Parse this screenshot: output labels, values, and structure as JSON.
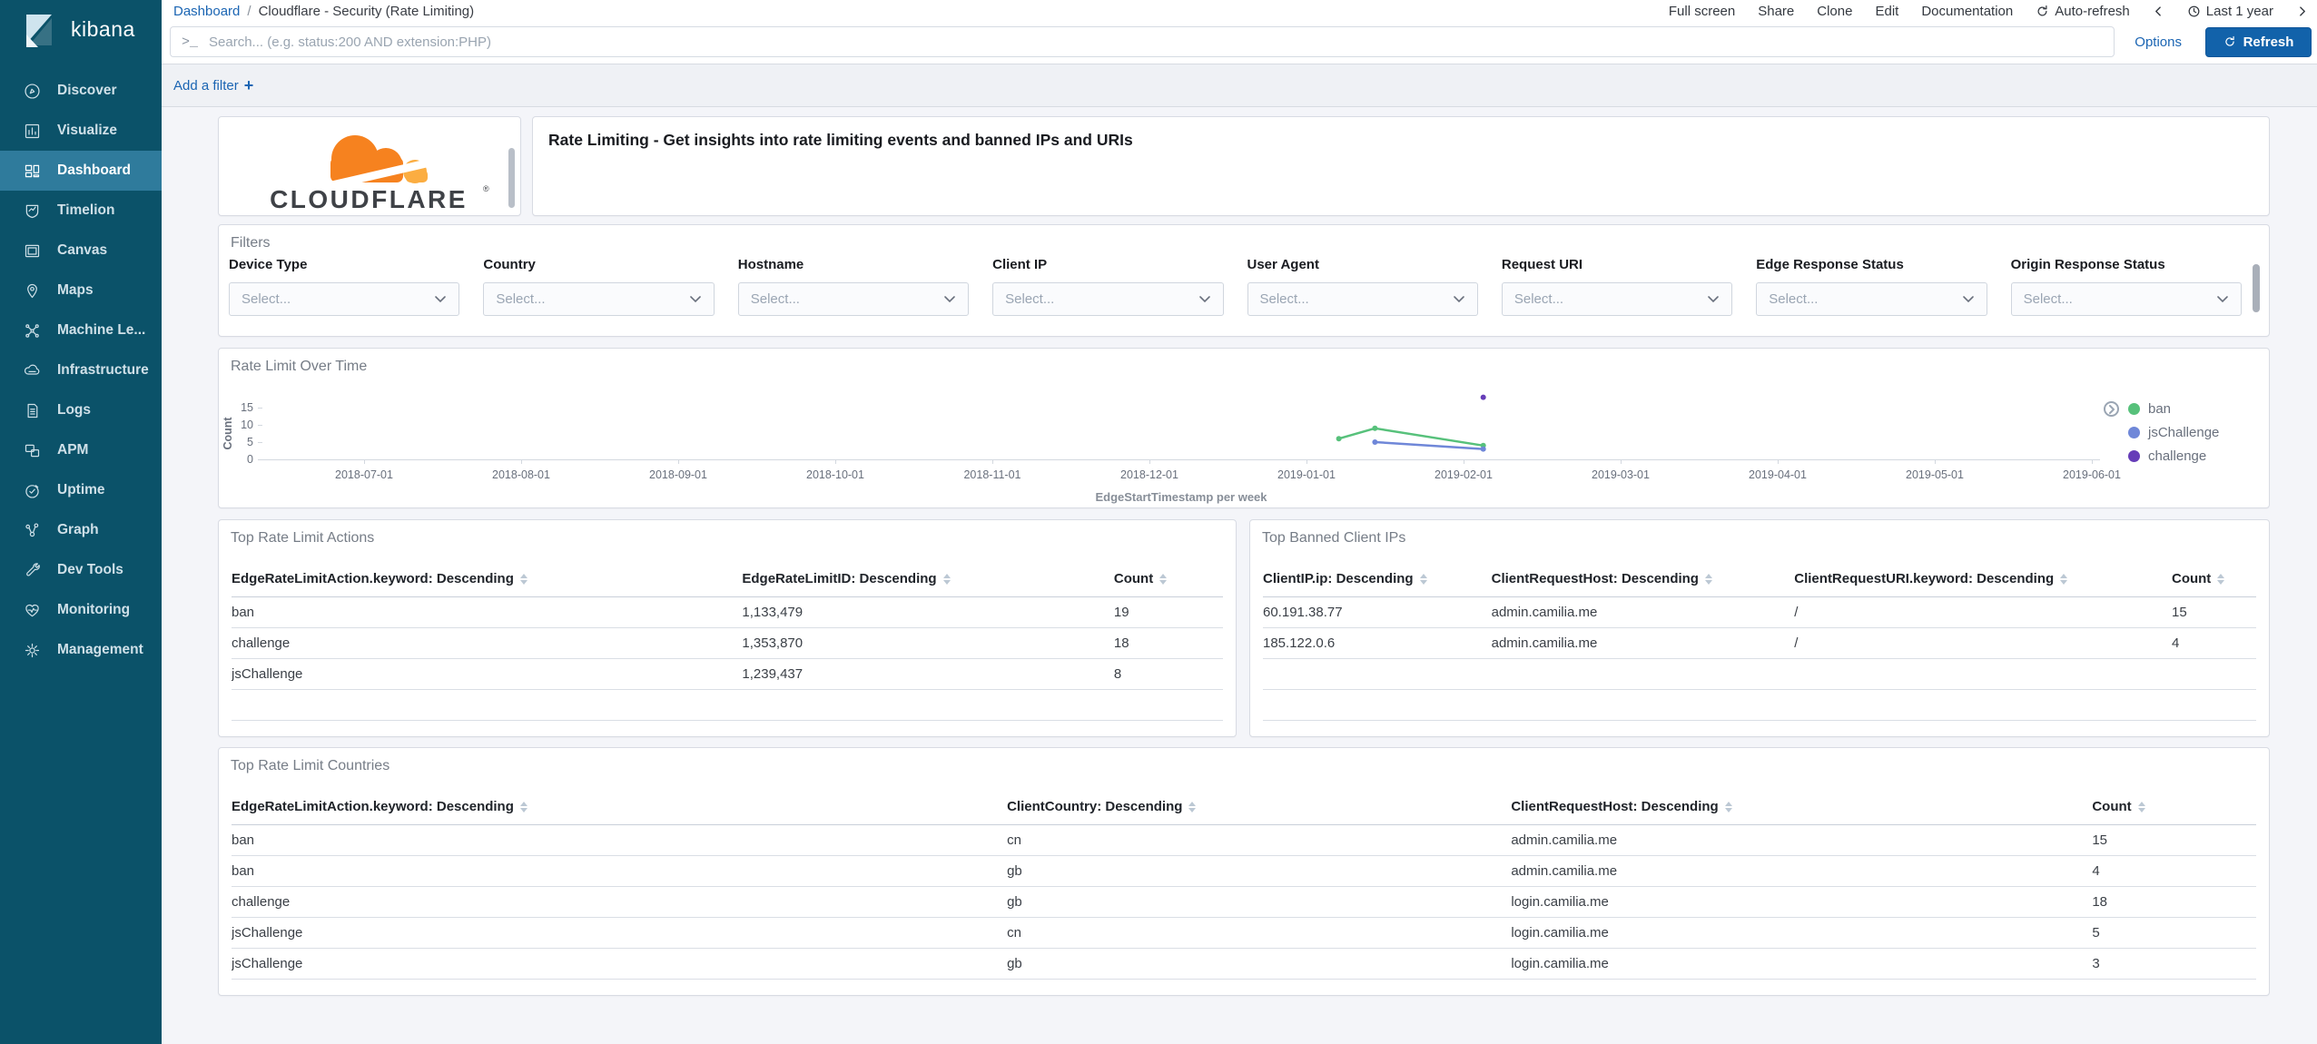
{
  "brand": {
    "name": "kibana"
  },
  "sidebar": {
    "items": [
      {
        "label": "Discover",
        "icon": "discover",
        "active": false
      },
      {
        "label": "Visualize",
        "icon": "visualize",
        "active": false
      },
      {
        "label": "Dashboard",
        "icon": "dashboard",
        "active": true
      },
      {
        "label": "Timelion",
        "icon": "timelion",
        "active": false
      },
      {
        "label": "Canvas",
        "icon": "canvas",
        "active": false
      },
      {
        "label": "Maps",
        "icon": "maps",
        "active": false
      },
      {
        "label": "Machine Le...",
        "icon": "machine-learning",
        "active": false
      },
      {
        "label": "Infrastructure",
        "icon": "infrastructure",
        "active": false
      },
      {
        "label": "Logs",
        "icon": "logs",
        "active": false
      },
      {
        "label": "APM",
        "icon": "apm",
        "active": false
      },
      {
        "label": "Uptime",
        "icon": "uptime",
        "active": false
      },
      {
        "label": "Graph",
        "icon": "graph",
        "active": false
      },
      {
        "label": "Dev Tools",
        "icon": "dev-tools",
        "active": false
      },
      {
        "label": "Monitoring",
        "icon": "monitoring",
        "active": false
      },
      {
        "label": "Management",
        "icon": "management",
        "active": false
      }
    ]
  },
  "breadcrumb": {
    "link": "Dashboard",
    "separator": "/",
    "current": "Cloudflare - Security (Rate Limiting)"
  },
  "topnav": {
    "menu": [
      "Full screen",
      "Share",
      "Clone",
      "Edit",
      "Documentation"
    ],
    "auto_refresh": "Auto-refresh",
    "time_range": "Last 1 year"
  },
  "querybar": {
    "prompt": ">_",
    "placeholder": "Search... (e.g. status:200 AND extension:PHP)",
    "options": "Options",
    "refresh": "Refresh"
  },
  "filterbar": {
    "add_filter": "Add a filter",
    "plus": "+"
  },
  "panels": {
    "logo": {
      "brand": "CLOUDFLARE",
      "registered": "®"
    },
    "header": {
      "text": "Rate Limiting - Get insights into rate limiting events and banned IPs and URIs"
    },
    "filters": {
      "title": "Filters",
      "placeholder": "Select...",
      "fields": [
        "Device Type",
        "Country",
        "Hostname",
        "Client IP",
        "User Agent",
        "Request URI",
        "Edge Response Status",
        "Origin Response Status"
      ]
    },
    "chart": {
      "title": "Rate Limit Over Time"
    },
    "actions_table": {
      "title": "Top Rate Limit Actions",
      "columns": [
        "EdgeRateLimitAction.keyword: Descending",
        "EdgeRateLimitID: Descending",
        "Count"
      ],
      "rows": [
        [
          "ban",
          "1,133,479",
          "19"
        ],
        [
          "challenge",
          "1,353,870",
          "18"
        ],
        [
          "jsChallenge",
          "1,239,437",
          "8"
        ]
      ]
    },
    "banned_table": {
      "title": "Top Banned Client IPs",
      "columns": [
        "ClientIP.ip: Descending",
        "ClientRequestHost: Descending",
        "ClientRequestURI.keyword: Descending",
        "Count"
      ],
      "rows": [
        [
          "60.191.38.77",
          "admin.camilia.me",
          "/",
          "15"
        ],
        [
          "185.122.0.6",
          "admin.camilia.me",
          "/",
          "4"
        ]
      ]
    },
    "countries_table": {
      "title": "Top Rate Limit Countries",
      "columns": [
        "EdgeRateLimitAction.keyword: Descending",
        "ClientCountry: Descending",
        "ClientRequestHost: Descending",
        "Count"
      ],
      "rows": [
        [
          "ban",
          "cn",
          "admin.camilia.me",
          "15"
        ],
        [
          "ban",
          "gb",
          "admin.camilia.me",
          "4"
        ],
        [
          "challenge",
          "gb",
          "login.camilia.me",
          "18"
        ],
        [
          "jsChallenge",
          "cn",
          "login.camilia.me",
          "5"
        ],
        [
          "jsChallenge",
          "gb",
          "login.camilia.me",
          "3"
        ]
      ]
    }
  },
  "chart_data": {
    "type": "line",
    "title": "Rate Limit Over Time",
    "xlabel": "EdgeStartTimestamp per week",
    "ylabel": "Count",
    "ylim": [
      0,
      20
    ],
    "y_ticks": [
      0,
      5,
      10,
      15
    ],
    "x_ticks": [
      "2018-07-01",
      "2018-08-01",
      "2018-09-01",
      "2018-10-01",
      "2018-11-01",
      "2018-12-01",
      "2019-01-01",
      "2019-02-01",
      "2019-03-01",
      "2019-04-01",
      "2019-05-01",
      "2019-06-01"
    ],
    "legend_position": "right",
    "series": [
      {
        "name": "ban",
        "color": "#57c17b",
        "points": [
          {
            "x": "2019-01-06",
            "y": 6
          },
          {
            "x": "2019-01-13",
            "y": 9
          },
          {
            "x": "2019-02-03",
            "y": 4
          }
        ]
      },
      {
        "name": "jsChallenge",
        "color": "#6f87d8",
        "points": [
          {
            "x": "2019-01-13",
            "y": 5
          },
          {
            "x": "2019-02-03",
            "y": 3
          }
        ]
      },
      {
        "name": "challenge",
        "color": "#663db8",
        "points": [
          {
            "x": "2019-02-03",
            "y": 18
          }
        ]
      }
    ]
  },
  "colors": {
    "sidebar": "#0b5269",
    "sidebar_active": "#2f7b9c",
    "link_blue": "#1b65b3",
    "button_blue": "#1262aa",
    "cloudflare_orange": "#f6821f",
    "cloudflare_light_orange": "#fbad41",
    "series_green": "#57c17b",
    "series_blue": "#6f87d8",
    "series_purple": "#663db8"
  }
}
